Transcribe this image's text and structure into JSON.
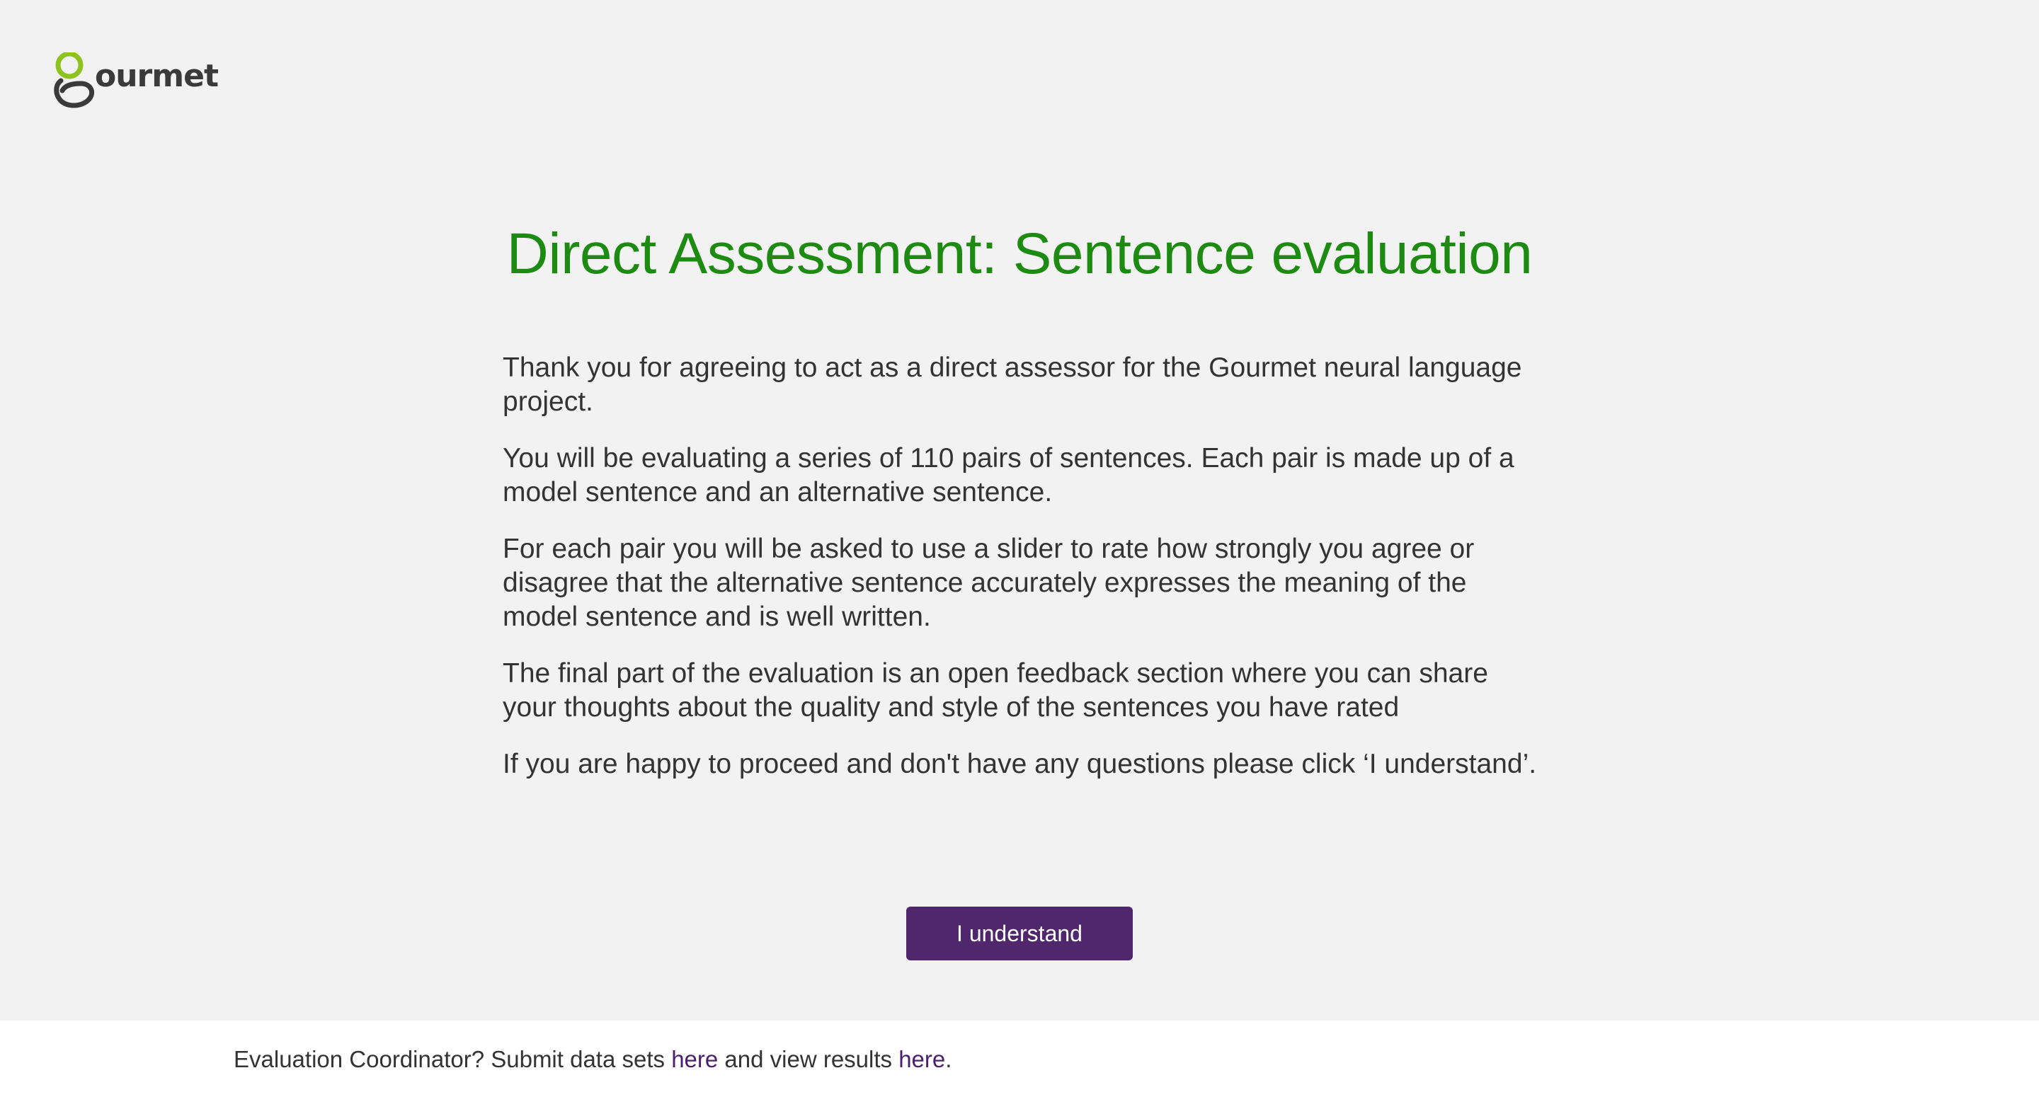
{
  "brand": {
    "logo_text": "ourmet",
    "logo_accent_color": "#8dc21f",
    "logo_letter_color": "#3a3a3a"
  },
  "page": {
    "title": "Direct Assessment: Sentence evaluation",
    "title_color": "#1d8a12",
    "paragraphs": [
      "Thank you for agreeing to act as a direct assessor for the Gourmet neural language project.",
      "You will be evaluating a series of 110 pairs of sentences. Each pair is made up of a model sentence and an alternative sentence.",
      "For each pair you will be asked to use a slider to rate how strongly you agree or disagree that the alternative sentence accurately expresses the meaning of the model sentence and is well written.",
      "The final part of the evaluation is an open feedback section where you can share your thoughts about the quality and style of the sentences you have rated",
      "If you are happy to proceed and don't have any questions please click ‘I understand’."
    ],
    "primary_button_label": "I understand",
    "primary_button_color": "#50266c"
  },
  "footer": {
    "prefix": "Evaluation Coordinator? Submit data sets ",
    "link1": "here",
    "middle": " and view results ",
    "link2": "here",
    "suffix": ".",
    "link_color": "#4b1f6d"
  }
}
